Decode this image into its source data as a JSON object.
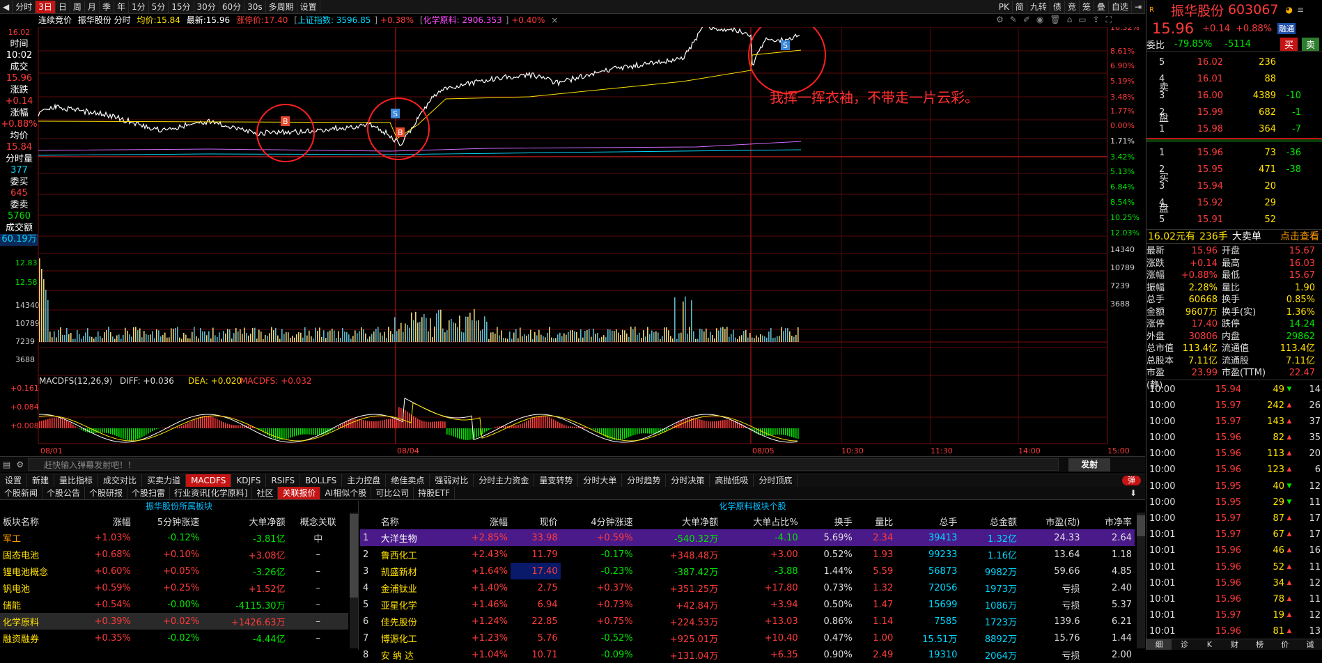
{
  "toolbar": {
    "items": [
      "分时",
      "3日",
      "日",
      "周",
      "月",
      "季",
      "年",
      "1分",
      "5分",
      "15分",
      "30分",
      "60分",
      "30s",
      "多周期",
      "设置"
    ],
    "active": "3日",
    "right": [
      "PK",
      "简",
      "九转",
      "债",
      "竞",
      "笼",
      "叠",
      "自选",
      "⇥"
    ]
  },
  "info": {
    "auction": "连续竞价",
    "stock": "振华股份 分时",
    "avg_label": "均价:",
    "avg": "15.84",
    "last_label": "最新:",
    "last": "15.96",
    "limit_label": "涨停价:",
    "limit": "17.40",
    "idx1": "上证指数: 3596.85",
    "idx1_chg": "+0.38%",
    "idx2": "化学原料: 2906.353",
    "idx2_chg": "+0.40%"
  },
  "left": {
    "price_top": "16.02",
    "time_l": "时间",
    "time": "10:02",
    "deal_l": "成交",
    "deal": "15.96",
    "chg_l": "涨跌",
    "chg": "+0.14",
    "pct_l": "涨幅",
    "pct": "+0.88%",
    "avgp_l": "均价",
    "avgp": "15.84",
    "vol_l": "分时量",
    "vol": "377",
    "buy_l": "委买",
    "buy": "645",
    "sell_l": "委卖",
    "sell": "5760",
    "amt_l": "成交额",
    "amt": "60.19万",
    "low_price": "12.83",
    "low_price2": "12.58",
    "vol_axis": [
      "14340",
      "10789",
      "7239",
      "3688"
    ]
  },
  "right_axis": {
    "pct": [
      "10.32%",
      "8.61%",
      "6.90%",
      "5.19%",
      "3.48%",
      "1.77%",
      "0.00%",
      "1.71%",
      "3.42%",
      "5.13%",
      "6.84%",
      "8.54%",
      "10.25%",
      "12.03%"
    ],
    "vol": [
      "14340",
      "10789",
      "7239",
      "3688"
    ]
  },
  "macd": {
    "label": "MACDFS(12,26,9)",
    "diff": "DIFF: +0.036",
    "dea": "DEA: +0.020",
    "macdfs": "MACDFS: +0.032",
    "axis": [
      "+0.161",
      "+0.084",
      "+0.008"
    ]
  },
  "xaxis": [
    "08/01",
    "08/04",
    "08/05",
    "10:30",
    "11:30",
    "14:00",
    "15:00"
  ],
  "annotation": "我挥一挥衣袖，不带走一片云彩。",
  "markers": [
    "B",
    "S",
    "B",
    "S"
  ],
  "danmu": {
    "placeholder": "赶快输入弹幕发射吧！！",
    "send": "发射"
  },
  "tabs1": {
    "items": [
      "设置",
      "新建",
      "量比指标",
      "成交对比",
      "买卖力道",
      "MACDFS",
      "KDJFS",
      "RSIFS",
      "BOLLFS",
      "主力控盘",
      "绝佳卖点",
      "强弱对比",
      "分时主力资金",
      "量变转势",
      "分时大单",
      "分时趋势",
      "分时决策",
      "高抛低吸",
      "分时顶底"
    ],
    "active": "MACDFS",
    "toggle": "弹"
  },
  "tabs2": {
    "items": [
      "个股新闻",
      "个股公告",
      "个股研报",
      "个股扫雷",
      "行业资讯[化学原料]",
      "社区",
      "关联报价",
      "AI相似个股",
      "可比公司",
      "持股ETF"
    ],
    "active": "关联报价"
  },
  "blocks": {
    "caption": "振华股份所属板块",
    "headers": [
      "板块名称",
      "涨幅",
      "5分钟涨速",
      "大单净额",
      "概念关联"
    ],
    "rows": [
      [
        "军工",
        "+1.03%",
        "-0.12%",
        "-3.81亿",
        "中"
      ],
      [
        "固态电池",
        "+0.68%",
        "+0.10%",
        "+3.08亿",
        "–"
      ],
      [
        "锂电池概念",
        "+0.60%",
        "+0.05%",
        "-3.26亿",
        "–"
      ],
      [
        "钒电池",
        "+0.59%",
        "+0.25%",
        "+1.52亿",
        "–"
      ],
      [
        "储能",
        "+0.54%",
        "-0.00%",
        "-4115.30万",
        "–"
      ],
      [
        "化学原料",
        "+0.39%",
        "+0.02%",
        "+1426.63万",
        "–"
      ],
      [
        "融资融券",
        "+0.35%",
        "-0.02%",
        "-4.44亿",
        "–"
      ]
    ]
  },
  "stocks": {
    "caption": "化学原料板块个股",
    "headers": [
      "",
      "名称",
      "涨幅",
      "现价",
      "4分钟涨速",
      "大单净额",
      "大单占比%",
      "换手",
      "量比",
      "总手",
      "总金额",
      "市盈(动)",
      "市净率"
    ],
    "rows": [
      [
        "1",
        "大洋生物",
        "+2.85%",
        "33.98",
        "+0.59%",
        "-540.32万",
        "-4.10",
        "5.69%",
        "2.34",
        "39413",
        "1.32亿",
        "24.33",
        "2.64"
      ],
      [
        "2",
        "鲁西化工",
        "+2.43%",
        "11.79",
        "-0.17%",
        "+348.48万",
        "+3.00",
        "0.52%",
        "1.93",
        "99233",
        "1.16亿",
        "13.64",
        "1.18"
      ],
      [
        "3",
        "凯盛新材",
        "+1.64%",
        "17.40",
        "-0.23%",
        "-387.42万",
        "-3.88",
        "1.44%",
        "5.59",
        "56873",
        "9982万",
        "59.66",
        "4.85"
      ],
      [
        "4",
        "金浦钛业",
        "+1.40%",
        "2.75",
        "+0.37%",
        "+351.25万",
        "+17.80",
        "0.73%",
        "1.32",
        "72056",
        "1973万",
        "亏损",
        "2.40"
      ],
      [
        "5",
        "亚星化学",
        "+1.46%",
        "6.94",
        "+0.73%",
        "+42.84万",
        "+3.94",
        "0.50%",
        "1.47",
        "15699",
        "1086万",
        "亏损",
        "5.37"
      ],
      [
        "6",
        "佳先股份",
        "+1.24%",
        "22.85",
        "+0.75%",
        "+224.53万",
        "+13.03",
        "0.86%",
        "1.14",
        "7585",
        "1723万",
        "139.6",
        "6.21"
      ],
      [
        "7",
        "博源化工",
        "+1.23%",
        "5.76",
        "-0.52%",
        "+925.01万",
        "+10.40",
        "0.47%",
        "1.00",
        "15.51万",
        "8892万",
        "15.76",
        "1.44"
      ],
      [
        "8",
        "安 纳 达",
        "+1.04%",
        "10.71",
        "-0.09%",
        "+131.04万",
        "+6.35",
        "0.90%",
        "2.49",
        "19310",
        "2064万",
        "亏损",
        "2.00"
      ]
    ]
  },
  "rp": {
    "r": "R",
    "name": "振华股份",
    "code": "603067",
    "price": "15.96",
    "chg": "+0.14",
    "pct": "+0.88%",
    "tag": "融通",
    "wb_l": "委比",
    "wb": "-79.85%",
    "wc": "-5114",
    "buy_btn": "买",
    "sell_btn": "卖",
    "asks": [
      [
        "5",
        "16.02",
        "236",
        ""
      ],
      [
        "4",
        "16.01",
        "88",
        ""
      ],
      [
        "3",
        "16.00",
        "4389",
        "-10"
      ],
      [
        "2",
        "15.99",
        "682",
        "-1"
      ],
      [
        "1",
        "15.98",
        "364",
        "-7"
      ]
    ],
    "bids": [
      [
        "1",
        "15.96",
        "73",
        "-36"
      ],
      [
        "2",
        "15.95",
        "471",
        "-38"
      ],
      [
        "3",
        "15.94",
        "20",
        ""
      ],
      [
        "4",
        "15.92",
        "29",
        ""
      ],
      [
        "5",
        "15.91",
        "52",
        ""
      ]
    ],
    "sell_l": "卖盘",
    "buy_l": "买盘",
    "bigorder": {
      "price": "16.02元有",
      "qty": "236手",
      "label": "大卖单",
      "link": "点击查看"
    },
    "stats": [
      [
        "最新",
        "15.96",
        "开盘",
        "15.67"
      ],
      [
        "涨跌",
        "+0.14",
        "最高",
        "16.03"
      ],
      [
        "涨幅",
        "+0.88%",
        "最低",
        "15.67"
      ],
      [
        "振幅",
        "2.28%",
        "量比",
        "1.90"
      ],
      [
        "总手",
        "60668",
        "换手",
        "0.85%"
      ],
      [
        "金额",
        "9607万",
        "换手(实)",
        "1.36%"
      ],
      [
        "涨停",
        "17.40",
        "跌停",
        "14.24"
      ],
      [
        "外盘",
        "30806",
        "内盘",
        "29862"
      ],
      [
        "总市值",
        "113.4亿",
        "流通值",
        "113.4亿"
      ],
      [
        "总股本",
        "7.11亿",
        "流通股",
        "7.11亿"
      ],
      [
        "市盈(静)",
        "23.99",
        "市盈(TTM)",
        "22.47"
      ]
    ],
    "ticks": [
      [
        "10:00",
        "15.94",
        "49",
        "14"
      ],
      [
        "10:00",
        "15.97",
        "242",
        "26"
      ],
      [
        "10:00",
        "15.97",
        "143",
        "37"
      ],
      [
        "10:00",
        "15.96",
        "82",
        "35"
      ],
      [
        "10:00",
        "15.96",
        "113",
        "20"
      ],
      [
        "10:00",
        "15.96",
        "123",
        "6"
      ],
      [
        "10:00",
        "15.95",
        "40",
        "12"
      ],
      [
        "10:00",
        "15.95",
        "29",
        "11"
      ],
      [
        "10:00",
        "15.97",
        "87",
        "17"
      ],
      [
        "10:01",
        "15.97",
        "67",
        "17"
      ],
      [
        "10:01",
        "15.96",
        "46",
        "16"
      ],
      [
        "10:01",
        "15.96",
        "52",
        "11"
      ],
      [
        "10:01",
        "15.96",
        "34",
        "12"
      ],
      [
        "10:01",
        "15.96",
        "78",
        "11"
      ],
      [
        "10:01",
        "15.97",
        "19",
        "12"
      ],
      [
        "10:01",
        "15.96",
        "81",
        "13"
      ]
    ],
    "bottom_tabs": [
      "细",
      "诊",
      "K",
      "财",
      "榜",
      "价",
      "诚"
    ]
  }
}
